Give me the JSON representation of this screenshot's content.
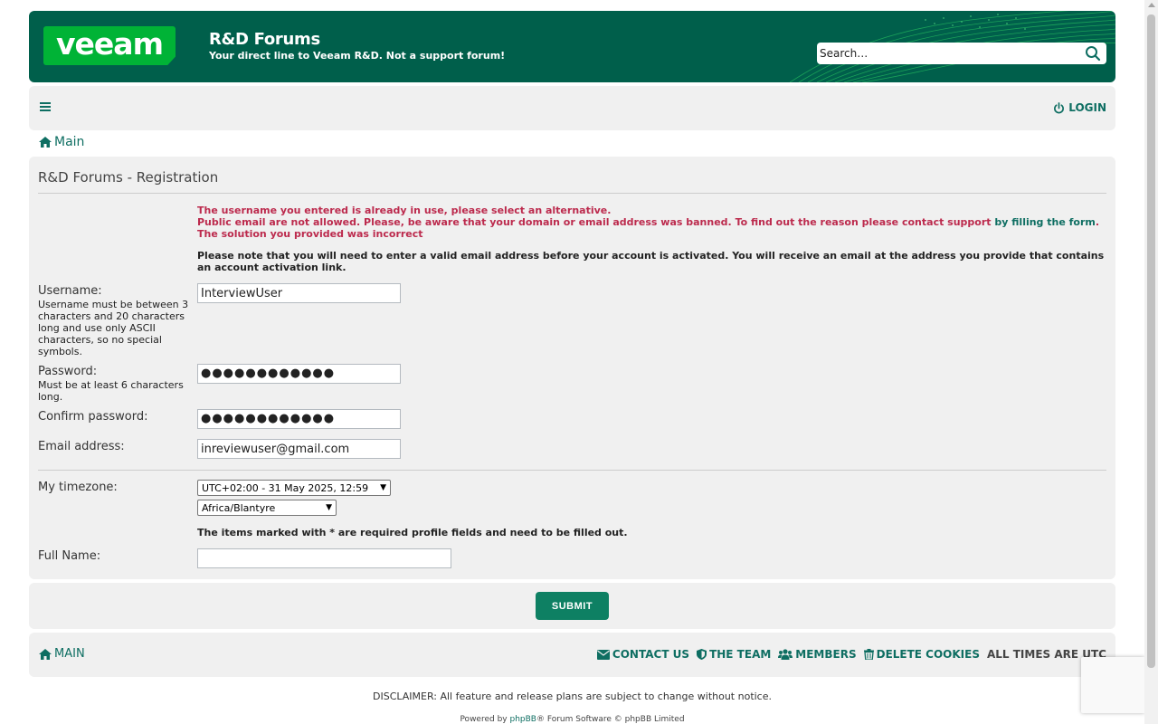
{
  "header": {
    "logo_text": "veeam",
    "title": "R&D Forums",
    "description": "Your direct line to Veeam R&D. Not a support forum!",
    "search_placeholder": "Search…"
  },
  "nav": {
    "menu_icon": "hamburger-icon",
    "login_label": "LOGIN"
  },
  "breadcrumb": {
    "home_label": "Main"
  },
  "form": {
    "title": "R&D Forums - Registration",
    "errors": {
      "username_taken": "The username you entered is already in use, please select an alternative.",
      "email_banned": "Public email are not allowed. Please, be aware that your domain or email address was banned. To find out the reason please contact support",
      "email_banned_link": "by filling the form",
      "email_banned_end": ".",
      "captcha_wrong": "The solution you provided was incorrect"
    },
    "notice": "Please note that you will need to enter a valid email address before your account is activated. You will receive an email at the address you provide that contains an account activation link.",
    "username": {
      "label": "Username:",
      "help": "Username must be between 3 characters and 20 characters long and use only ASCII characters, so no special symbols.",
      "value": "InterviewUser"
    },
    "password": {
      "label": "Password:",
      "help": "Must be at least 6 characters long.",
      "value": "●●●●●●●●●●●●"
    },
    "confirm_password": {
      "label": "Confirm password:",
      "value": "●●●●●●●●●●●●"
    },
    "email": {
      "label": "Email address:",
      "value": "inreviewuser@gmail.com"
    },
    "timezone": {
      "label": "My timezone:",
      "offset_selected": "UTC+02:00 - 31 May 2025, 12:59",
      "zone_selected": "Africa/Blantyre"
    },
    "required_note": "The items marked with * are required profile fields and need to be filled out.",
    "full_name": {
      "label": "Full Name:",
      "value": ""
    },
    "submit_label": "SUBMIT"
  },
  "footer": {
    "main_label": "MAIN",
    "contact_label": "CONTACT US",
    "team_label": "THE TEAM",
    "members_label": "MEMBERS",
    "delete_cookies_label": "DELETE COOKIES",
    "timezone_note": "ALL TIMES ARE UTC",
    "disclaimer": "DISCLAIMER: All feature and release plans are subject to change without notice.",
    "powered_prefix": "Powered by",
    "powered_link": "phpBB",
    "powered_suffix": "® Forum Software © phpBB Limited"
  },
  "colors": {
    "brand_green": "#005f4b",
    "logo_green": "#00b336",
    "link_teal": "#0e6e62",
    "error_red": "#bc2a4d",
    "button_green": "#0e8063"
  }
}
